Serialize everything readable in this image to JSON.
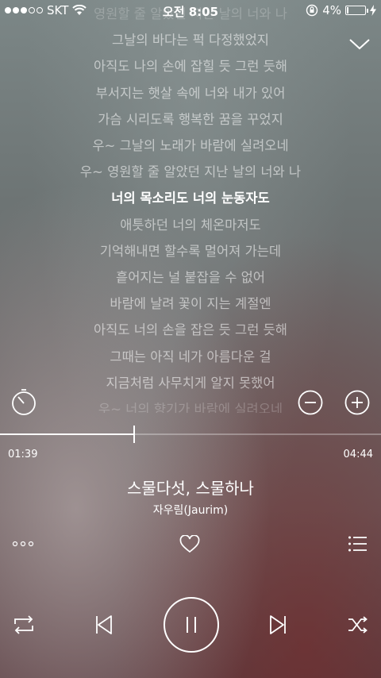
{
  "status_bar": {
    "carrier": "SKT",
    "time": "오전 8:05",
    "battery_percent": "4%",
    "battery_level": 0.04
  },
  "lyrics": [
    "영원할 줄 알았던 지난 날의 너와 나",
    "그날의 바다는 퍽 다정했었지",
    "아직도 나의 손에 잡힐 듯 그런 듯해",
    "부서지는 햇살 속에 너와 내가 있어",
    "가슴 시리도록 행복한 꿈을 꾸었지",
    "우~ 그날의 노래가 바람에 실려오네",
    "우~ 영원할 줄 알았던 지난 날의 너와 나",
    "너의 목소리도 너의 눈동자도",
    "애틋하던 너의 체온마저도",
    "기억해내면 할수록 멀어져 가는데",
    "흩어지는 널 붙잡을 수 없어",
    "바람에 날려 꽃이 지는 계절엔",
    "아직도 너의 손을 잡은 듯 그런 듯해",
    "그때는 아직 네가 아름다운 걸",
    "지금처럼 사무치게 알지 못했어",
    "우~ 너의 향기가 바람에 실려오네"
  ],
  "current_lyric_index": 7,
  "player": {
    "current_time": "01:39",
    "total_time": "04:44",
    "progress": 0.349,
    "song_title": "스물다섯, 스물하나",
    "artist": "자우림(Jaurim)"
  }
}
